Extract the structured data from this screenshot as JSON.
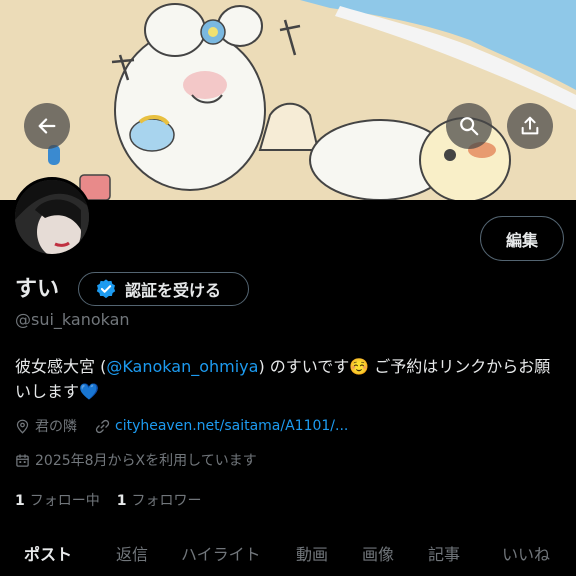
{
  "profile": {
    "name": "すい",
    "handle": "@sui_kanokan",
    "edit_label": "編集",
    "verify_label": "認証を受ける",
    "bio_prefix": "彼女感大宮 (",
    "bio_mention": "@Kanokan_ohmiya",
    "bio_suffix": ") のすいです☺️ ご予約はリンクからお願いします💙",
    "location": "君の隣",
    "website": "cityheaven.net/saitama/A1101/...",
    "joined": "2025年8月からXを利用しています",
    "following_count": "1",
    "following_label": "フォロー中",
    "followers_count": "1",
    "followers_label": "フォロワー"
  },
  "tabs": [
    {
      "label": "ポスト",
      "active": true
    },
    {
      "label": "返信"
    },
    {
      "label": "ハイライト"
    },
    {
      "label": "動画"
    },
    {
      "label": "画像"
    },
    {
      "label": "記事"
    },
    {
      "label": "いいね"
    }
  ],
  "icons": {
    "back": "arrow-left-icon",
    "search": "search-icon",
    "share": "share-icon",
    "verified": "verified-badge-icon",
    "location": "location-pin-icon",
    "link": "link-icon",
    "calendar": "calendar-icon"
  },
  "colors": {
    "accent": "#1d9bf0",
    "text": "#e7e9ea",
    "muted": "#71767b",
    "border": "#536471",
    "background": "#000000"
  }
}
